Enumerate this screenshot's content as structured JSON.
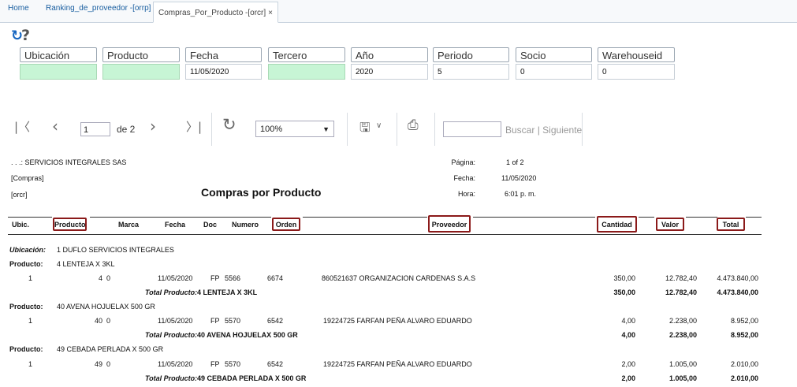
{
  "tabs": [
    {
      "label": "Home"
    },
    {
      "label": "Ranking_de_proveedor -[orrp]",
      "close": "×"
    },
    {
      "label": "Compras_Por_Producto -[orcr]",
      "close": "×"
    }
  ],
  "toolbar_top": {
    "refresh_icon": "refresh-icon",
    "help_icon": "question-icon"
  },
  "params": [
    {
      "label": "Ubicación",
      "value": ""
    },
    {
      "label": "Producto",
      "value": ""
    },
    {
      "label": "Fecha",
      "value": "11/05/2020"
    },
    {
      "label": "Tercero",
      "value": ""
    },
    {
      "label": "Año",
      "value": "2020"
    },
    {
      "label": "Periodo",
      "value": "5"
    },
    {
      "label": "Socio",
      "value": "0"
    },
    {
      "label": "Warehouseid",
      "value": "0"
    }
  ],
  "viewer": {
    "page": "1",
    "of_pages": "de 2",
    "zoom": "100%",
    "find": "Buscar",
    "separator": "|",
    "next": "Siguiente"
  },
  "report": {
    "company": ". . .: SERVICIOS INTEGRALES SAS",
    "module": "[Compras]",
    "code": "[orcr]",
    "title": "Compras por Producto",
    "pagina_label": "Página:",
    "pagina": "1 of 2",
    "fecha_label": "Fecha:",
    "fecha": "11/05/2020",
    "hora_label": "Hora:",
    "hora": "6:01 p. m.",
    "columns": [
      "Ubic.",
      "Producto",
      "Marca",
      "Fecha",
      "Doc",
      "Numero",
      "Orden",
      "Proveedor",
      "Cantidad",
      "Valor",
      "Total"
    ],
    "ubicacion_label": "Ubicación:",
    "ubicacion": "1 DUFLO SERVICIOS INTEGRALES",
    "producto_label": "Producto:",
    "total_label": "Total Producto:",
    "groups": [
      {
        "producto": "4 LENTEJA X 3KL",
        "row": {
          "ubic": "1",
          "producto": "4",
          "marca": "0",
          "fecha": "11/05/2020",
          "doc": "FP",
          "numero": "5566",
          "orden": "6674",
          "proveedor": "860521637  ORGANIZACION CARDENAS S.A.S",
          "cantidad": "350,00",
          "valor": "12.782,40",
          "total": "4.473.840,00"
        },
        "total_name": "4 LENTEJA X 3KL",
        "tot_cantidad": "350,00",
        "tot_valor": "12.782,40",
        "tot_total": "4.473.840,00"
      },
      {
        "producto": "40 AVENA HOJUELAX 500 GR",
        "row": {
          "ubic": "1",
          "producto": "40",
          "marca": "0",
          "fecha": "11/05/2020",
          "doc": "FP",
          "numero": "5570",
          "orden": "6542",
          "proveedor": "19224725  FARFAN PEÑA  ALVARO EDUARDO",
          "cantidad": "4,00",
          "valor": "2.238,00",
          "total": "8.952,00"
        },
        "total_name": "40 AVENA HOJUELAX 500 GR",
        "tot_cantidad": "4,00",
        "tot_valor": "2.238,00",
        "tot_total": "8.952,00"
      },
      {
        "producto": "49 CEBADA PERLADA X 500 GR",
        "row": {
          "ubic": "1",
          "producto": "49",
          "marca": "0",
          "fecha": "11/05/2020",
          "doc": "FP",
          "numero": "5570",
          "orden": "6542",
          "proveedor": "19224725  FARFAN PEÑA  ALVARO EDUARDO",
          "cantidad": "2,00",
          "valor": "1.005,00",
          "total": "2.010,00"
        },
        "total_name": "49 CEBADA PERLADA X 500 GR",
        "tot_cantidad": "2,00",
        "tot_valor": "1.005,00",
        "tot_total": "2.010,00"
      }
    ]
  }
}
